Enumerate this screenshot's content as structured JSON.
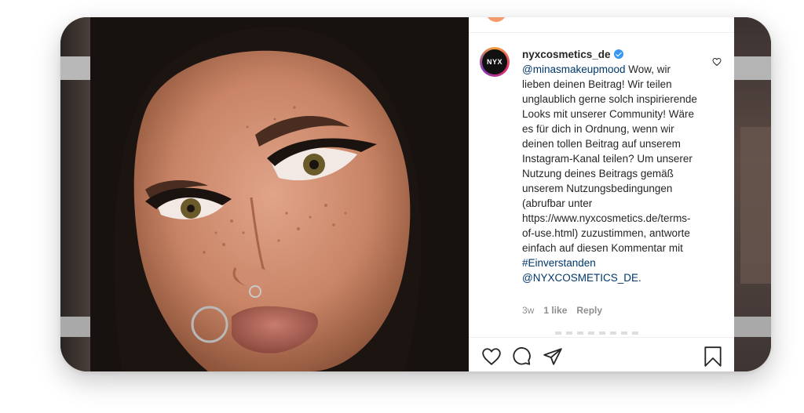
{
  "post": {
    "avatar_logo_text": "NYX",
    "comment_user": "nyxcosmetics_de",
    "mention": "@minasmakeupmood",
    "body_part1": " Wow, wir lieben deinen Beitrag! Wir teilen unglaublich gerne solch inspirierende Looks mit unserer Community! Wäre es für dich in Ordnung, wenn wir deinen tollen Beitrag auf unserem Instagram-Kanal teilen? Um unserer Nutzung deines Beitrags gemäß unserem Nutzungsbedingungen (abrufbar unter https://www.nyxcosmetics.de/terms-of-use.html) zuzustimmen, antworte einfach auf diesen Kommentar mit ",
    "hashtag": "#Einverstanden",
    "mention_end": "@NYXCOSMETICS_DE",
    "period": ".",
    "time": "3w",
    "likes": "1 like",
    "reply": "Reply"
  },
  "colors": {
    "link": "#00376b",
    "verified": "#3897f0",
    "meta": "#8e8e8e"
  },
  "icons": [
    "heart-icon",
    "comment-icon",
    "share-icon",
    "bookmark-icon",
    "verified-icon"
  ]
}
